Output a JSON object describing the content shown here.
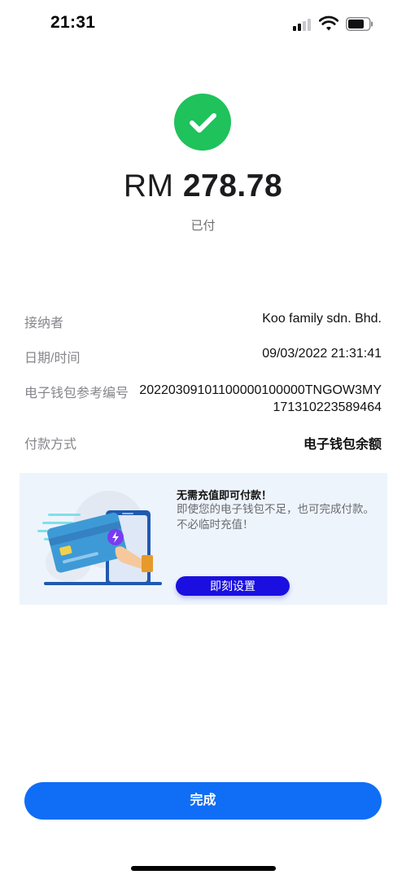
{
  "status_bar": {
    "time": "21:31",
    "signal_icon": "cellular-signal-icon",
    "wifi_icon": "wifi-icon",
    "battery_icon": "battery-icon"
  },
  "receipt": {
    "status_icon": "checkmark-icon",
    "status_color": "#1fc25b",
    "currency": "RM",
    "amount": "278.78",
    "status_text": "已付"
  },
  "details": [
    {
      "label": "接纳者",
      "value": "Koo family sdn. Bhd."
    },
    {
      "label": "日期/时间",
      "value": "09/03/2022 21:31:41"
    },
    {
      "label": "电子钱包参考编号",
      "value": "20220309101100000100000TNGOW3MY171310223589464"
    },
    {
      "label": "付款方式",
      "value": "电子钱包余额"
    }
  ],
  "promo": {
    "title": "无需充值即可付款！",
    "description": "即使您的电子钱包不足，也可完成付款。不必临时充值！",
    "button_label": "即刻设置",
    "button_color": "#1a0fe0",
    "illustration": "card-phone-payment-illustration"
  },
  "footer": {
    "done_label": "完成",
    "accent_color": "#0f6ef5"
  }
}
